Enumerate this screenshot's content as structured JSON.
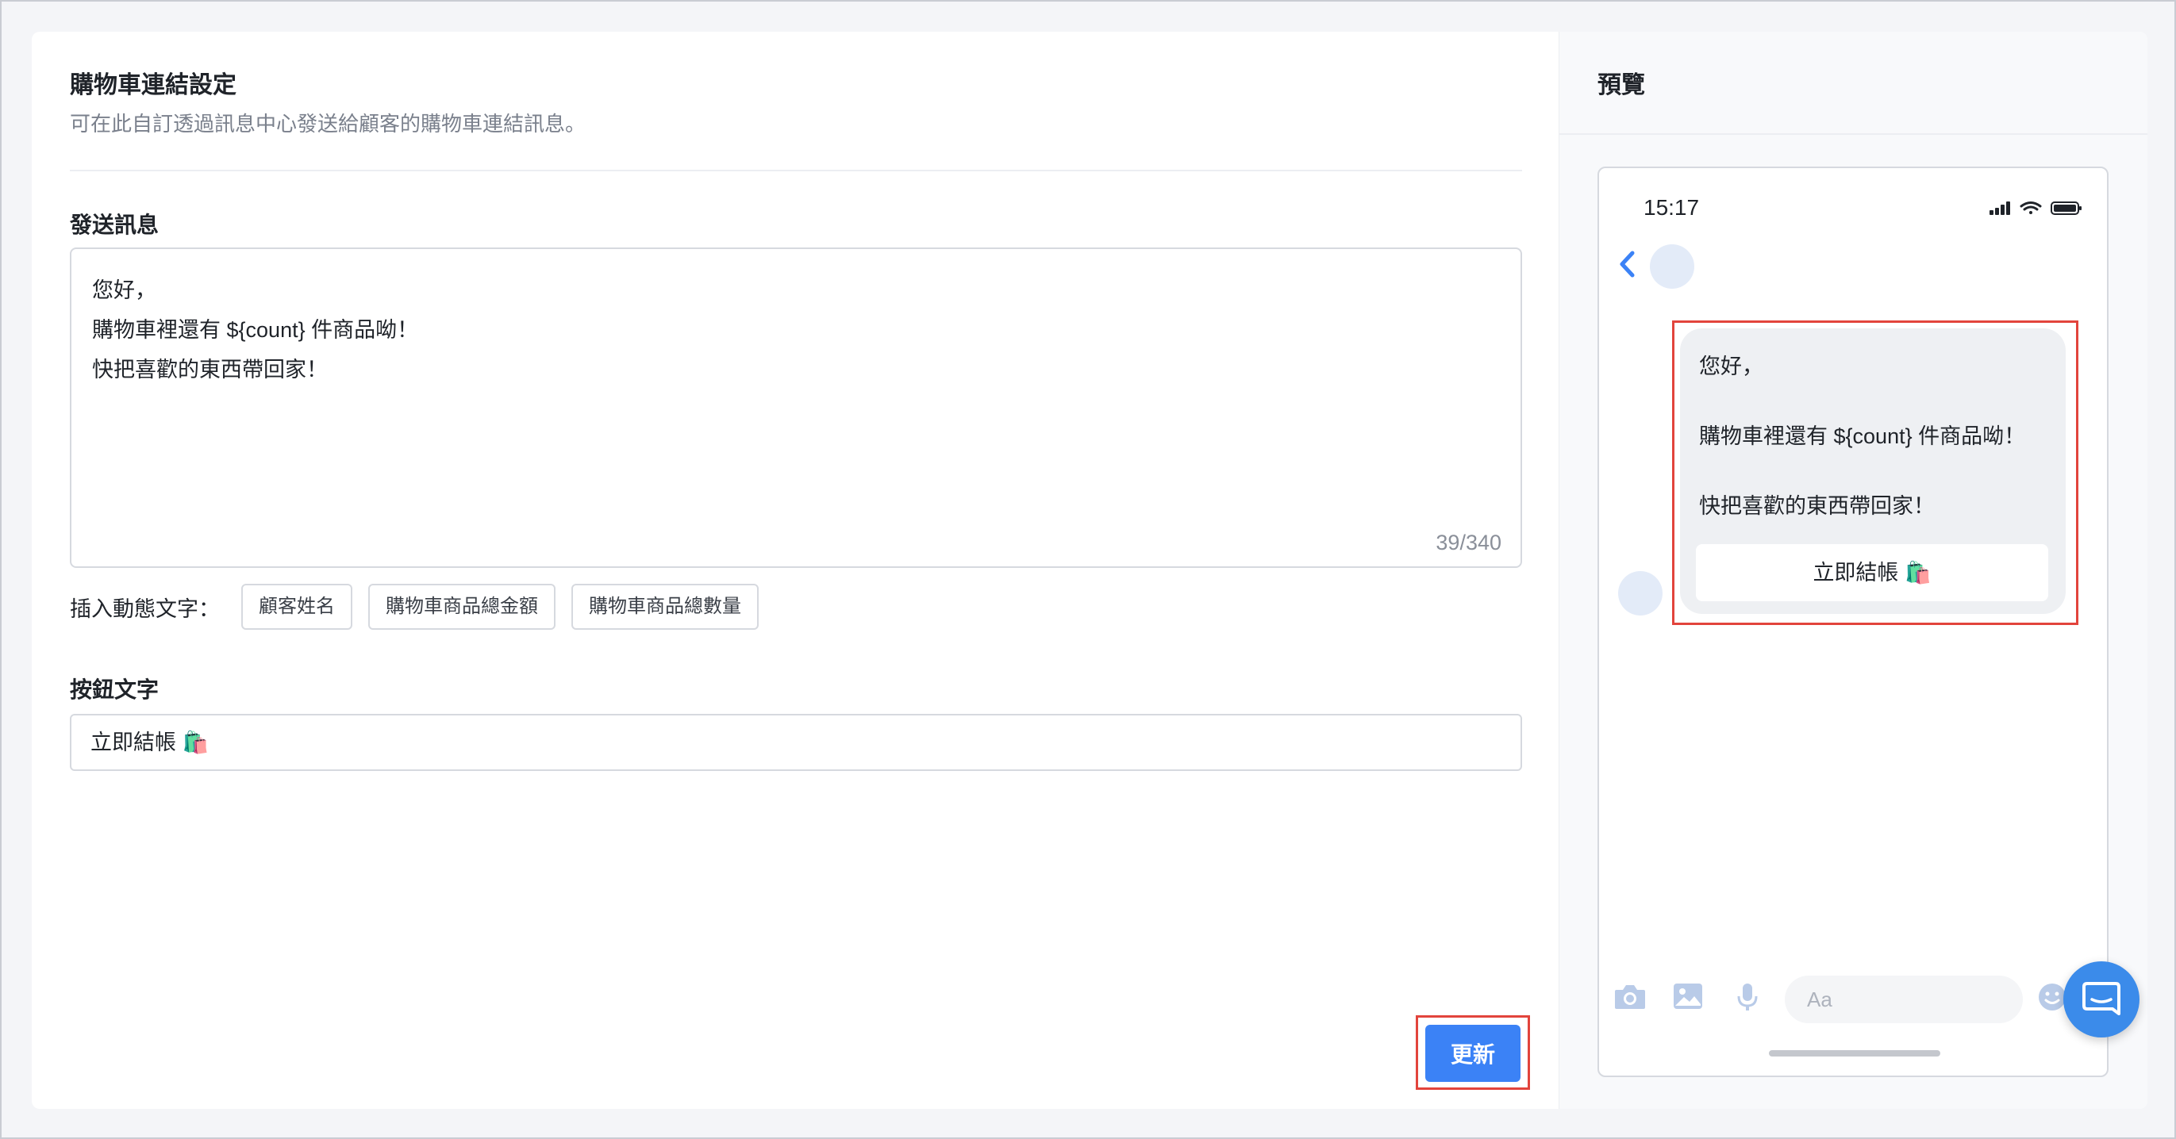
{
  "settings": {
    "title": "購物車連結設定",
    "description": "可在此自訂透過訊息中心發送給顧客的購物車連結訊息。",
    "message_label": "發送訊息",
    "message_lines": [
      "您好，",
      "購物車裡還有 ${count} 件商品呦！",
      "快把喜歡的東西帶回家！"
    ],
    "char_counter": "39/340",
    "insert_label": "插入動態文字：",
    "chips": [
      "顧客姓名",
      "購物車商品總金額",
      "購物車商品總數量"
    ],
    "button_label": "按鈕文字",
    "button_text_value": "立即結帳 🛍️",
    "update_button": "更新"
  },
  "preview": {
    "title": "預覽",
    "time": "15:17",
    "bubble_lines": [
      "您好，",
      "購物車裡還有 ${count} 件商品呦！",
      "快把喜歡的東西帶回家！"
    ],
    "bubble_button": "立即結帳 🛍️",
    "input_placeholder": "Aa"
  },
  "colors": {
    "accent": "#3b82f6",
    "highlight": "#e2443c",
    "fab": "#3b8bea"
  },
  "icons": [
    "back-chevron-icon",
    "camera-icon",
    "image-icon",
    "microphone-icon",
    "emoji-icon",
    "signal-icon",
    "wifi-icon",
    "battery-icon",
    "chat-icon"
  ]
}
